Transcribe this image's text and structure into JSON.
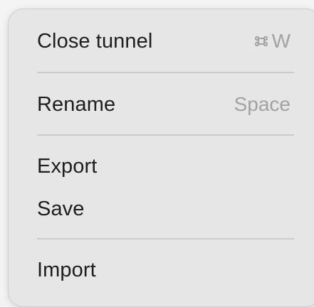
{
  "menu": {
    "items": [
      {
        "label": "Close tunnel",
        "shortcut_key": "W",
        "shortcut_icon": "command-icon"
      },
      {
        "label": "Rename",
        "shortcut_text": "Space"
      },
      {
        "label": "Export"
      },
      {
        "label": "Save"
      },
      {
        "label": "Import"
      }
    ]
  },
  "colors": {
    "menu_background": "#e6e6e6",
    "label_text": "#1e1e1e",
    "shortcut_text": "#a2a2a2",
    "separator": "#cbcbcb"
  }
}
